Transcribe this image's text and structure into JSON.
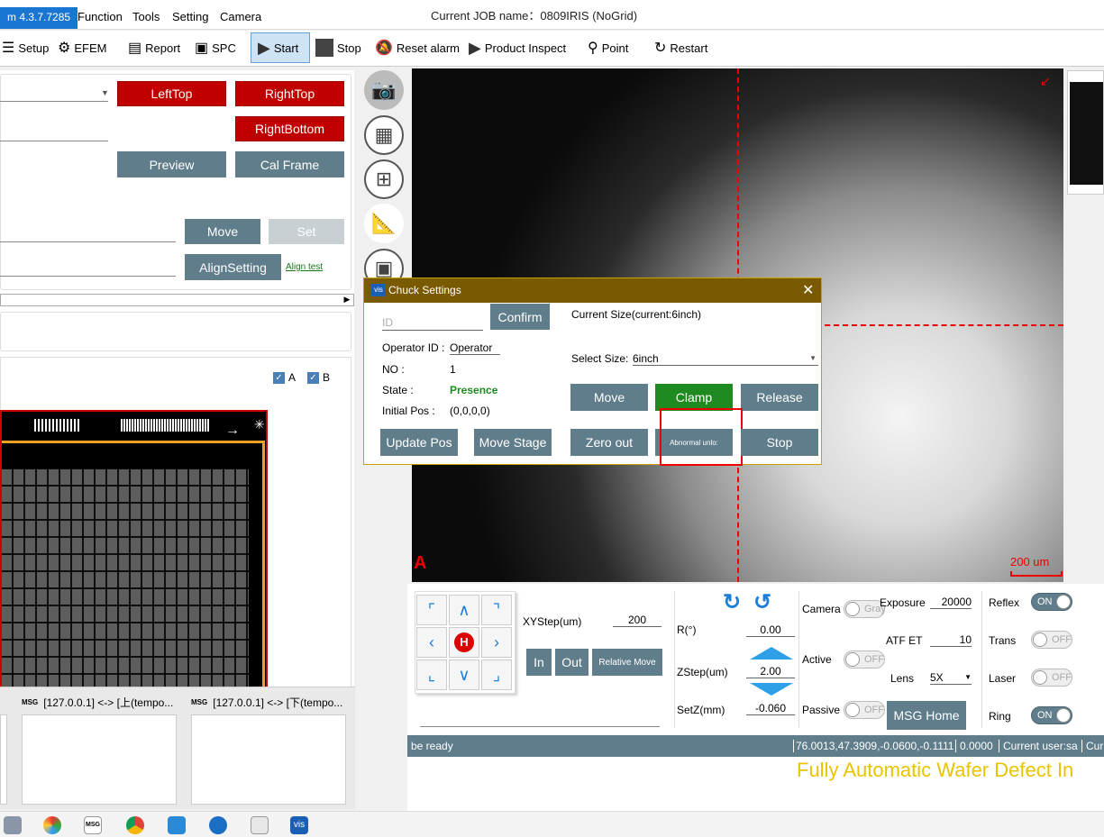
{
  "app": {
    "version": "m 4.3.7.7285",
    "job_title": "Current JOB name：0809IRIS (NoGrid)"
  },
  "menu": [
    "Function",
    "Tools",
    "Setting",
    "Camera"
  ],
  "toolbar": {
    "setup": "Setup",
    "efem": "EFEM",
    "report": "Report",
    "spc": "SPC",
    "start": "Start",
    "stop": "Stop",
    "reset_alarm": "Reset alarm",
    "product_inspect": "Product Inspect",
    "point": "Point",
    "restart": "Restart"
  },
  "left": {
    "lefttop": "LeftTop",
    "righttop": "RightTop",
    "rightbottom": "RightBottom",
    "preview": "Preview",
    "cal_frame": "Cal Frame",
    "move": "Move",
    "set": "Set",
    "align_setting": "AlignSetting",
    "align_test": "Align test",
    "check_a": "A",
    "check_b": "B"
  },
  "dialog": {
    "title": "Chuck Settings",
    "id_placeholder": "ID",
    "confirm": "Confirm",
    "current_size": "Current Size(current:6inch)",
    "operator_label": "Operator ID :",
    "operator_value": "Operator",
    "no_label": "NO :",
    "no_value": "1",
    "state_label": "State :",
    "state_value": "Presence",
    "initial_label": "Initial Pos :",
    "initial_value": "(0,0,0,0)",
    "select_size_label": "Select Size:",
    "select_size_value": "6inch",
    "move": "Move",
    "clamp": "Clamp",
    "release": "Release",
    "update_pos": "Update Pos",
    "move_stage": "Move Stage",
    "zero_out": "Zero out",
    "abnormal": "Abnormal unlo:",
    "stop": "Stop"
  },
  "camera": {
    "scale": "200 um",
    "marker": "A"
  },
  "controls": {
    "xystep_label": "XYStep(um)",
    "xystep_value": "200",
    "in": "In",
    "out": "Out",
    "relative_move": "Relative Move",
    "r_label": "R(°)",
    "r_value": "0.00",
    "zstep_label": "ZStep(um)",
    "zstep_value": "2.00",
    "setz_label": "SetZ(mm)",
    "setz_value": "-0.060",
    "camera_label": "Camera",
    "camera_toggle": "Gray",
    "active_label": "Active",
    "active_toggle": "OFF",
    "passive_label": "Passive",
    "passive_toggle": "OFF",
    "exposure_label": "Exposure",
    "exposure_value": "20000",
    "atf_label": "ATF ET",
    "atf_value": "10",
    "lens_label": "Lens",
    "lens_value": "5X",
    "msg_home": "MSG Home",
    "reflex_label": "Reflex",
    "reflex_toggle": "ON",
    "trans_label": "Trans",
    "trans_toggle": "OFF",
    "laser_label": "Laser",
    "laser_toggle": "OFF",
    "ring_label": "Ring",
    "ring_toggle": "ON",
    "home_icon": "H"
  },
  "status": {
    "ready": "be ready",
    "coords": "76.0013,47.3909,-0.0600,-0.1111",
    "value": "0.0000",
    "user": "Current user:sa",
    "cur": "Cur"
  },
  "banner": "Fully Automatic Wafer Defect In",
  "taskbar_windows": [
    "[127.0.0.1] <-> [上(tempo...",
    "[127.0.0.1] <-> [下(tempo..."
  ],
  "colors": {
    "red": "#c00000",
    "slate": "#607d8b",
    "green": "#1f8a1f",
    "banner": "#e8c400"
  }
}
